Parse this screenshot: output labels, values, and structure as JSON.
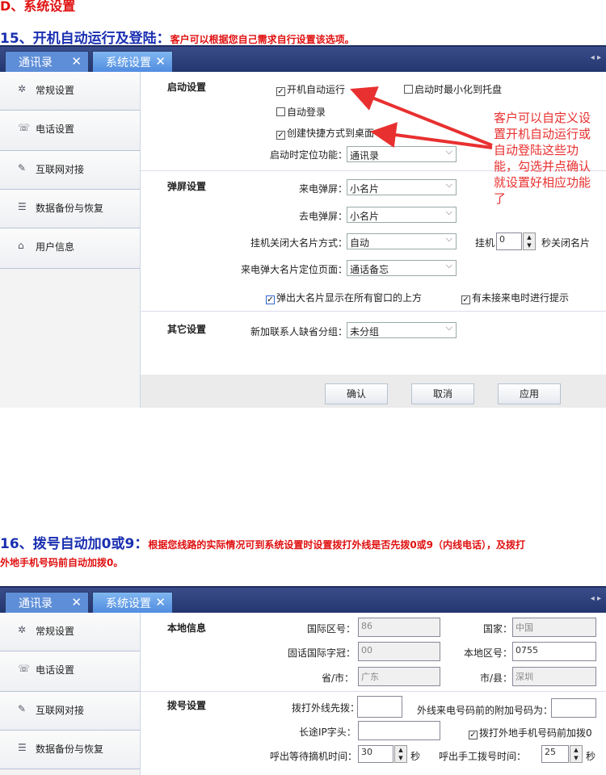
{
  "doc": {
    "top_heading": "D、系统设置",
    "s15": {
      "num": "15、开机自动运行及登陆：",
      "desc": "客户可以根据您自己需求自行设置该选项。"
    },
    "s16": {
      "num": "16、拨号自动加0或9：",
      "desc1": "根据您线路的实际情况可到系统设置时设置拨打外线是否先拨0或9（内线电话），及拨打",
      "desc2": "外地手机号码前自动加拨0。"
    }
  },
  "tabs": [
    {
      "label": "通讯录",
      "close": "✕"
    },
    {
      "label": "系统设置",
      "close": "✕"
    }
  ],
  "tab_arrows": "◂ ▸",
  "sidebar": {
    "items": [
      {
        "label": "常规设置",
        "icon": "gear-icon"
      },
      {
        "label": "电话设置",
        "icon": "phone-icon"
      },
      {
        "label": "互联网对接",
        "icon": "pencil-icon"
      },
      {
        "label": "数据备份与恢复",
        "icon": "document-icon"
      },
      {
        "label": "用户信息",
        "icon": "house-icon"
      }
    ]
  },
  "panel1": {
    "startup": {
      "title": "启动设置",
      "auto_run": "开机自动运行",
      "minimize": "启动时最小化到托盘",
      "auto_login": "自动登录",
      "shortcut": "创建快捷方式到桌面",
      "locate_label": "启动时定位功能：",
      "locate_value": "通讯录"
    },
    "popup": {
      "title": "弹屏设置",
      "incoming_label": "来电弹屏：",
      "incoming_value": "小名片",
      "outgoing_label": "去电弹屏：",
      "outgoing_value": "小名片",
      "close_label": "挂机关闭大名片方式：",
      "close_value": "自动",
      "hangup_label": "挂机",
      "hangup_value": "0",
      "hangup_suffix": "秒关闭名片",
      "page_label": "来电弹大名片定位页面：",
      "page_value": "通话备忘",
      "on_top": "弹出大名片显示在所有窗口的上方",
      "missed": "有未接来电时进行提示"
    },
    "other": {
      "title": "其它设置",
      "group_label": "新加联系人缺省分组：",
      "group_value": "未分组"
    },
    "buttons": {
      "ok": "确认",
      "cancel": "取消",
      "apply": "应用"
    },
    "note": "客户可以自定义设置开机自动运行或自动登陆这些功能，勾选并点确认就设置好相应功能了"
  },
  "panel2": {
    "local": {
      "title": "本地信息",
      "intl_label": "国际区号：",
      "intl_value": "86",
      "country_label": "国家：",
      "country_value": "中国",
      "prefix_label": "固话国际字冠：",
      "prefix_value": "00",
      "area_label": "本地区号：",
      "area_value": "0755",
      "province_label": "省/市：",
      "province_value": "广东",
      "city_label": "市/县：",
      "city_value": "深圳"
    },
    "dial": {
      "title": "拨号设置",
      "outside_label": "拨打外线先拨：",
      "outside_value": "",
      "extra_label": "外线来电号码前的附加号码为：",
      "extra_value": "",
      "ip_label": "长途IP字头：",
      "ip_value": "",
      "mobile_zero": "拨打外地手机号码前加拨0",
      "wait_label": "呼出等待摘机时间：",
      "wait_value": "30",
      "wait_unit": "秒",
      "manual_label": "呼出手工拨号时间：",
      "manual_value": "25",
      "manual_unit": "秒"
    }
  },
  "colors": {
    "tabbar": "#2a3c76",
    "accent": "#e83030",
    "heading": "#1a2fb0"
  }
}
